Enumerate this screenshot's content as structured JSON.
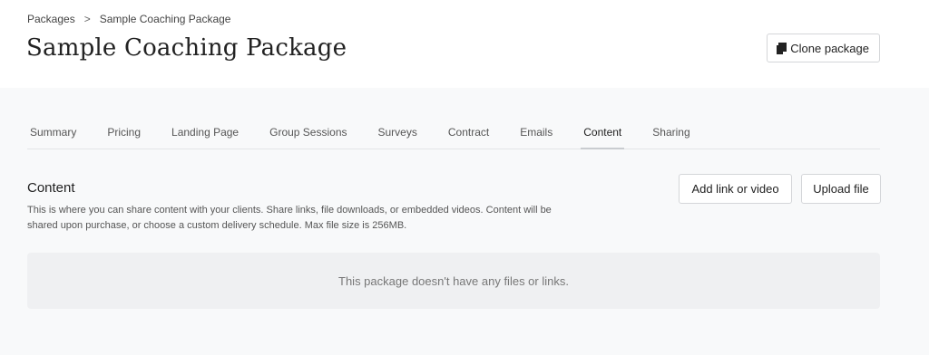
{
  "breadcrumb": {
    "parent": "Packages",
    "separator": ">",
    "current": "Sample Coaching Package"
  },
  "header": {
    "title": "Sample Coaching Package",
    "clone_label": "Clone package"
  },
  "tabs": [
    {
      "label": "Summary"
    },
    {
      "label": "Pricing"
    },
    {
      "label": "Landing Page"
    },
    {
      "label": "Group Sessions"
    },
    {
      "label": "Surveys"
    },
    {
      "label": "Contract"
    },
    {
      "label": "Emails"
    },
    {
      "label": "Content",
      "active": true
    },
    {
      "label": "Sharing"
    }
  ],
  "content": {
    "title": "Content",
    "description": "This is where you can share content with your clients. Share links, file downloads, or embedded videos. Content will be shared upon purchase, or choose a custom delivery schedule. Max file size is 256MB.",
    "add_link_label": "Add link or video",
    "upload_label": "Upload file",
    "empty_message": "This package doesn't have any files or links."
  },
  "icons": {
    "clone": "copy-icon"
  }
}
